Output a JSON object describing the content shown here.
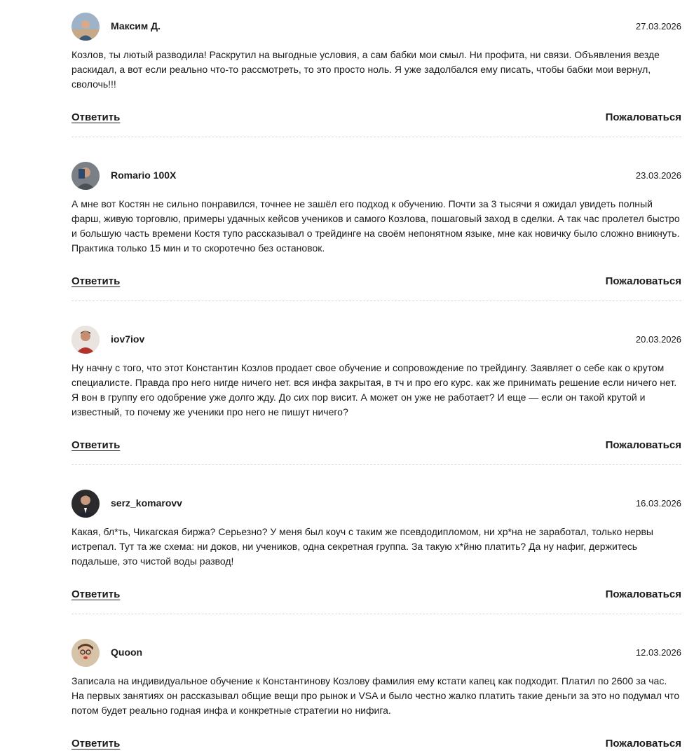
{
  "comments": [
    {
      "author": "Максим Д.",
      "date": "27.03.2026",
      "text": "Козлов, ты лютый разводила! Раскрутил на выгодные условия, а сам бабки мои смыл. Ни профита, ни связи. Объявления везде раскидал, а вот если реально что-то рассмотреть, то это просто ноль. Я уже задолбался ему писать, чтобы бабки мои вернул, сволочь!!!",
      "reply_label": "Ответить",
      "report_label": "Пожаловаться",
      "avatar_icon": "user-avatar-photo"
    },
    {
      "author": "Romario 100X",
      "date": "23.03.2026",
      "text": "А мне вот Костян не сильно понравился, точнее не зашёл его подход к обучению. Почти за 3 тысячи я ожидал увидеть полный фарш, живую торговлю, примеры удачных кейсов учеников и самого Козлова, пошаговый заход в сделки. А так час пролетел быстро и большую часть времени Костя тупо рассказывал о трейдинге на своём непонятном языке, мне как новичку было сложно вникнуть. Практика только 15 мин и то скоротечно без остановок.",
      "reply_label": "Ответить",
      "report_label": "Пожаловаться",
      "avatar_icon": "user-avatar-photo"
    },
    {
      "author": "iov7iov",
      "date": "20.03.2026",
      "text": "Ну начну с того, что этот Константин Козлов продает свое обучение и сопровождение по трейдингу. Заявляет о себе как о крутом специалисте. Правда про него нигде ничего нет. вся инфа закрытая, в тч и про его курс. как же принимать решение если ничего нет. Я вон в группу его одобрение уже долго жду. До сих пор висит. А может он уже не работает? И еще — если он такой крутой и известный, то почему же ученики про него не пишут ничего?",
      "reply_label": "Ответить",
      "report_label": "Пожаловаться",
      "avatar_icon": "user-avatar-photo"
    },
    {
      "author": "serz_komarovv",
      "date": "16.03.2026",
      "text": "Какая, бл*ть, Чикагская биржа? Серьезно? У меня был коуч с таким же псевдодипломом, ни хр*на не заработал, только нервы истрепал. Тут та же схема: ни доков, ни учеников, одна секретная группа. За такую х*йню платить? Да ну нафиг, держитесь подальше, это чистой воды развод!",
      "reply_label": "Ответить",
      "report_label": "Пожаловаться",
      "avatar_icon": "user-avatar-photo"
    },
    {
      "author": "Quoon",
      "date": "12.03.2026",
      "text": "Записала на индивидуальное обучение к Константинову Козлову фамилия ему кстати капец как подходит. Платил по 2600 за час. На первых занятиях он рассказывал общие вещи про рынок и VSA и было честно жалко платить такие деньги за это но подумал что потом будет реально годная инфа и конкретные стратегии но нифига.",
      "reply_label": "Ответить",
      "report_label": "Пожаловаться",
      "avatar_icon": "user-avatar-photo"
    }
  ]
}
